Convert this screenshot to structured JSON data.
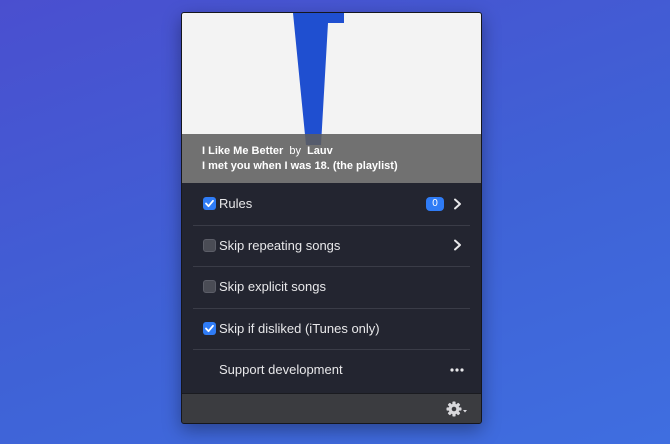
{
  "now_playing": {
    "title": "I Like Me Better",
    "by": "by",
    "artist": "Lauv",
    "album": "I met you when I was 18. (the playlist)"
  },
  "menu": {
    "items": [
      {
        "label": "Rules",
        "checked": true,
        "badge": "0",
        "has_chevron": true
      },
      {
        "label": "Skip repeating songs",
        "checked": false,
        "has_chevron": true
      },
      {
        "label": "Skip explicit songs",
        "checked": false
      },
      {
        "label": "Skip if disliked (iTunes only)",
        "checked": true
      },
      {
        "label": "Support development",
        "has_more": true
      }
    ]
  },
  "footer": {
    "icon": "gear-icon"
  },
  "colors": {
    "accent": "#2f7cf6",
    "panel": "#232530",
    "artwork_logo": "#1f4fd0"
  }
}
